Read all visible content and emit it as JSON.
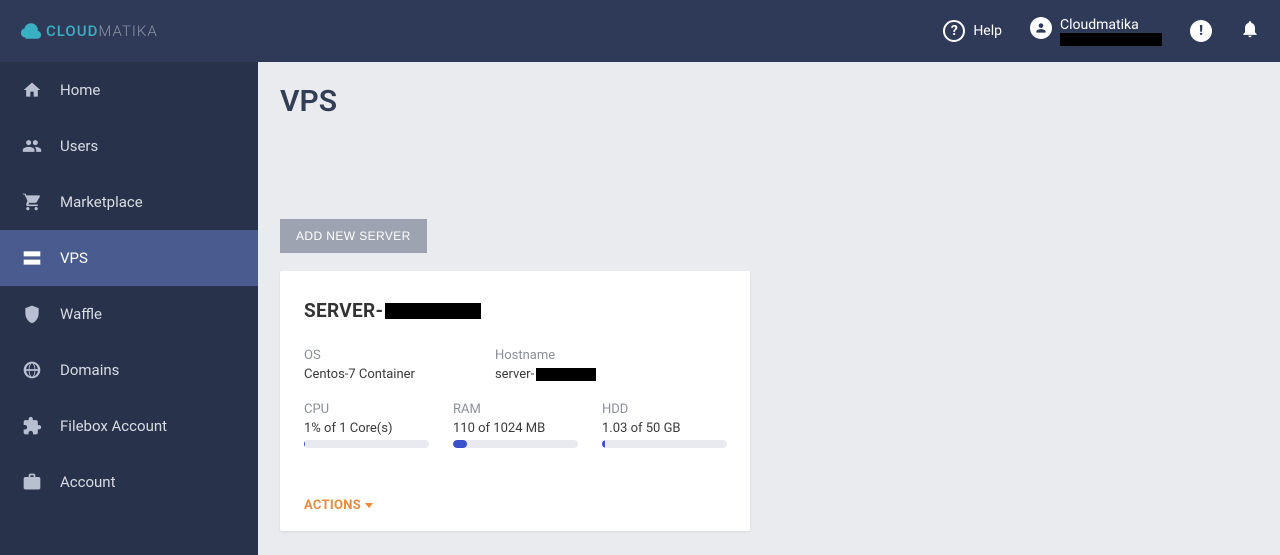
{
  "brand": {
    "cloud": "CLOUD",
    "matika": "MATIKA"
  },
  "topbar": {
    "help_label": "Help",
    "user_name": "Cloudmatika"
  },
  "sidebar": {
    "items": [
      {
        "label": "Home",
        "icon": "home"
      },
      {
        "label": "Users",
        "icon": "users"
      },
      {
        "label": "Marketplace",
        "icon": "cart"
      },
      {
        "label": "VPS",
        "icon": "server"
      },
      {
        "label": "Waffle",
        "icon": "shield"
      },
      {
        "label": "Domains",
        "icon": "globe"
      },
      {
        "label": "Filebox Account",
        "icon": "puzzle"
      },
      {
        "label": "Account",
        "icon": "briefcase"
      }
    ],
    "active_index": 3
  },
  "page": {
    "title": "VPS",
    "add_server_label": "ADD NEW SERVER"
  },
  "server": {
    "title_prefix": "SERVER-",
    "os_label": "OS",
    "os_value": "Centos-7 Container",
    "hostname_label": "Hostname",
    "hostname_prefix": "server-",
    "cpu_label": "CPU",
    "cpu_value": "1% of 1 Core(s)",
    "cpu_pct": 1,
    "ram_label": "RAM",
    "ram_value": "110 of 1024 MB",
    "ram_pct": 11,
    "hdd_label": "HDD",
    "hdd_value": "1.03 of 50 GB",
    "hdd_pct": 2,
    "actions_label": "ACTIONS"
  }
}
